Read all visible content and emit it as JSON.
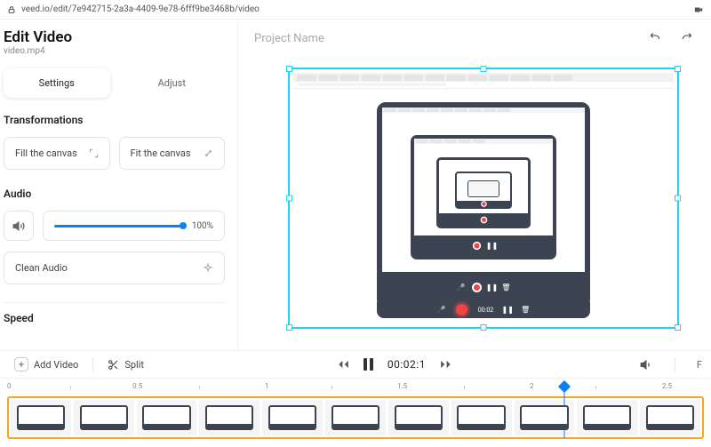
{
  "url": "veed.io/edit/7e942715-2a3a-4409-9e78-6fff9be3468b/video",
  "sidebar": {
    "title": "Edit Video",
    "filename": "video.mp4",
    "tabs": {
      "settings": "Settings",
      "adjust": "Adjust"
    },
    "transformations": {
      "title": "Transformations",
      "fill": "Fill the canvas",
      "fit": "Fit the canvas"
    },
    "audio": {
      "title": "Audio",
      "volume_pct": "100%",
      "clean": "Clean Audio"
    },
    "speed": {
      "title": "Speed"
    }
  },
  "preview": {
    "projectName": "Project Name"
  },
  "toolbar": {
    "addVideo": "Add Video",
    "split": "Split",
    "time": "00:02:1",
    "fit": "F"
  },
  "ruler": {
    "marks": [
      "0",
      "0.5",
      "1",
      "1.5",
      "2",
      "2.5"
    ]
  }
}
